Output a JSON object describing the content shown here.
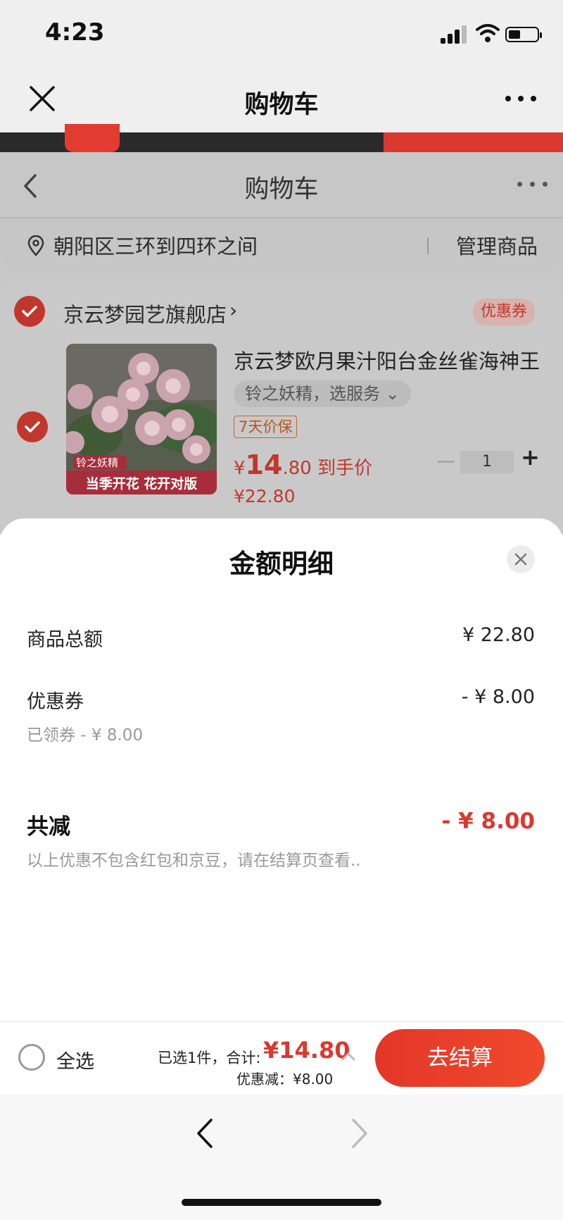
{
  "status_bar": {
    "time": "4:23"
  },
  "wechat_bar": {
    "title": "购物车"
  },
  "jd_page": {
    "title": "购物车",
    "address": "朝阳区三环到四环之间",
    "manage_label": "管理商品",
    "store": {
      "name": "京云梦园艺旗舰店",
      "chevron": "›",
      "coupon_tag": "优惠券"
    },
    "product": {
      "title": "京云梦欧月果汁阳台金丝雀海神王",
      "spec": "铃之妖精，选服务 ⌄",
      "guarantee": "7天价保",
      "price_symbol": "¥",
      "price_main": "14",
      "price_decimal": ".80",
      "price_suffix": "到手价",
      "original_price": "¥22.80",
      "quantity": "1",
      "minus": "−",
      "plus": "+",
      "image_tag": "铃之妖精",
      "image_caption": "当季开花 花开对版"
    }
  },
  "sheet": {
    "title": "金额明细",
    "rows": [
      {
        "label": "商品总额",
        "value": "¥ 22.80"
      },
      {
        "label": "优惠券",
        "value": "- ¥ 8.00",
        "sub": "已领券 - ¥ 8.00"
      }
    ],
    "total": {
      "label": "共减",
      "value": "- ¥ 8.00",
      "note": "以上优惠不包含红包和京豆，请在结算页查看.."
    }
  },
  "bottom_bar": {
    "select_all": "全选",
    "selected_count": "已选1件，合计:",
    "sum": "¥14.80",
    "discount": "优惠减：¥8.00",
    "checkout": "去结算"
  },
  "colors": {
    "accent": "#d9392f",
    "checkout_gradient_start": "#e3362a",
    "checkout_gradient_end": "#f04a2b"
  },
  "icons": [
    "close-icon",
    "more-icon",
    "back-icon",
    "location-pin-icon",
    "checkmark-icon",
    "chevron-up-icon",
    "nav-back-icon",
    "nav-forward-icon"
  ]
}
